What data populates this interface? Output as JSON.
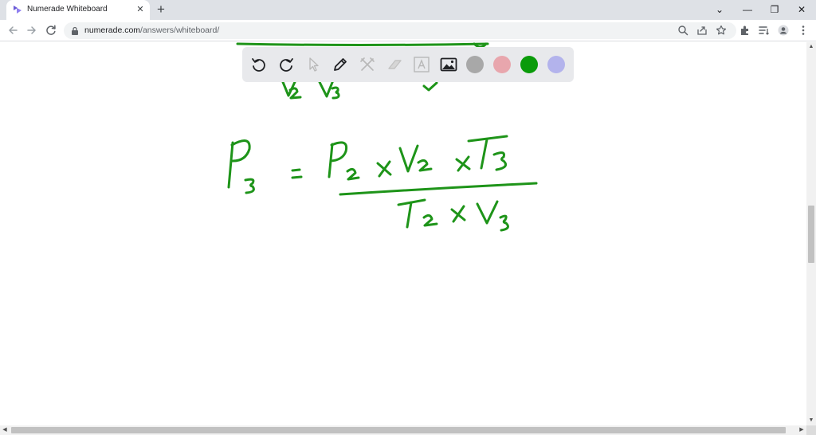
{
  "browser": {
    "tab_title": "Numerade Whiteboard",
    "tab_close_glyph": "✕",
    "new_tab_glyph": "+",
    "url_host": "numerade.com",
    "url_path": "/answers/whiteboard/",
    "window_controls": [
      "⌄",
      "—",
      "❐",
      "✕"
    ],
    "nav_icons": [
      "back-arrow-icon",
      "forward-arrow-icon",
      "reload-icon"
    ],
    "toolbar_icons": [
      "zoom-icon",
      "share-icon",
      "bookmark-star-icon",
      "extensions-icon",
      "reading-list-icon",
      "profile-icon",
      "kebab-menu-icon"
    ]
  },
  "whiteboard": {
    "tools": [
      "undo-icon",
      "redo-icon",
      "pointer-icon",
      "pen-icon",
      "tools-icon",
      "eraser-icon",
      "text-icon",
      "image-icon"
    ],
    "colors": {
      "swatches": [
        "#a8a8a8",
        "#e8a6ad",
        "#0a9b0a",
        "#b3b3ec"
      ],
      "ink": "#1e9419",
      "toolbar_bg": "#e8e9ec"
    },
    "equation": "P3 = P2 x V2 x T3 / T2 x V3"
  }
}
